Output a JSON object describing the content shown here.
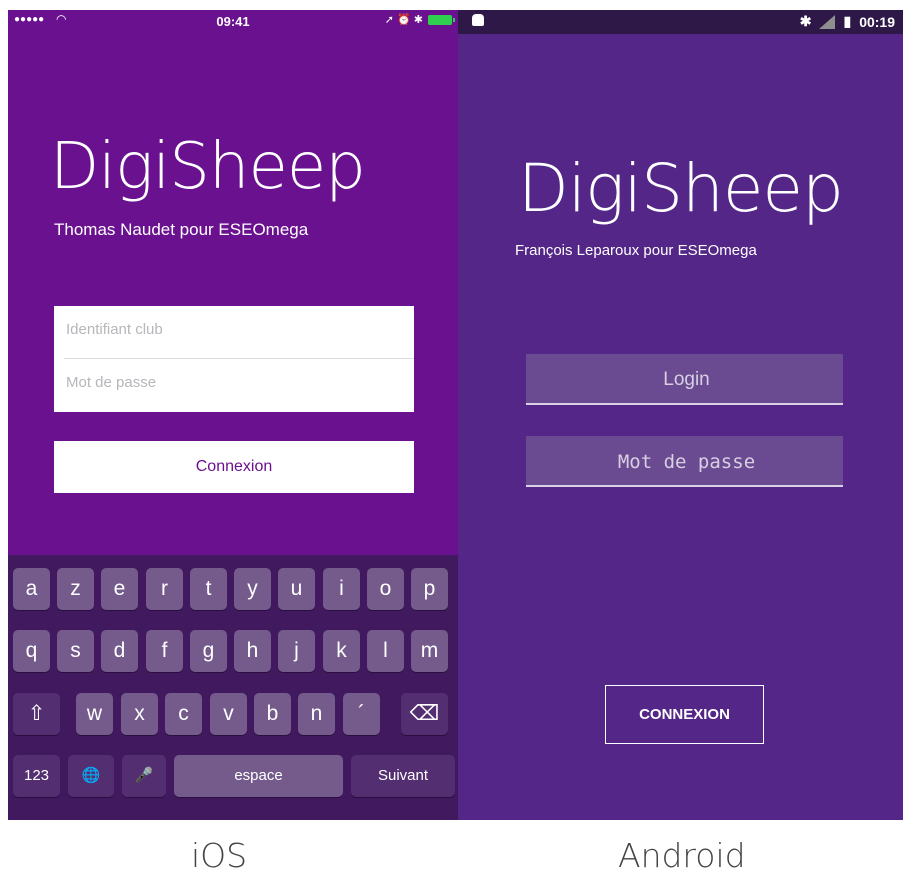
{
  "ios": {
    "status": {
      "signal": "●●●●●",
      "wifi": "wifi-icon",
      "time": "09:41",
      "right": "➚ ⏰ ✱"
    },
    "title": "DigiSheep",
    "subtitle": "Thomas Naudet pour ESEOmega",
    "fields": {
      "username_placeholder": "Identifiant club",
      "password_placeholder": "Mot de passe"
    },
    "button": "Connexion",
    "keyboard": {
      "row1": [
        "a",
        "z",
        "e",
        "r",
        "t",
        "y",
        "u",
        "i",
        "o",
        "p"
      ],
      "row2": [
        "q",
        "s",
        "d",
        "f",
        "g",
        "h",
        "j",
        "k",
        "l",
        "m"
      ],
      "row3": [
        "w",
        "x",
        "c",
        "v",
        "b",
        "n",
        "´"
      ],
      "shift": "⇧",
      "backspace": "⌫",
      "numbers": "123",
      "globe": "🌐",
      "mic": "🎤",
      "space": "espace",
      "next": "Suivant"
    }
  },
  "android": {
    "status": {
      "bluetooth": "✱",
      "time": "00:19"
    },
    "title": "DigiSheep",
    "subtitle": "François Leparoux pour ESEOmega",
    "fields": {
      "login_placeholder": "Login",
      "password_placeholder": "Mot de passe"
    },
    "button": "CONNEXION"
  },
  "captions": {
    "ios": "iOS",
    "android": "Android"
  },
  "colors": {
    "ios_bg": "#6a1190",
    "android_bg": "#532687",
    "keyboard_bg": "#40195e"
  }
}
